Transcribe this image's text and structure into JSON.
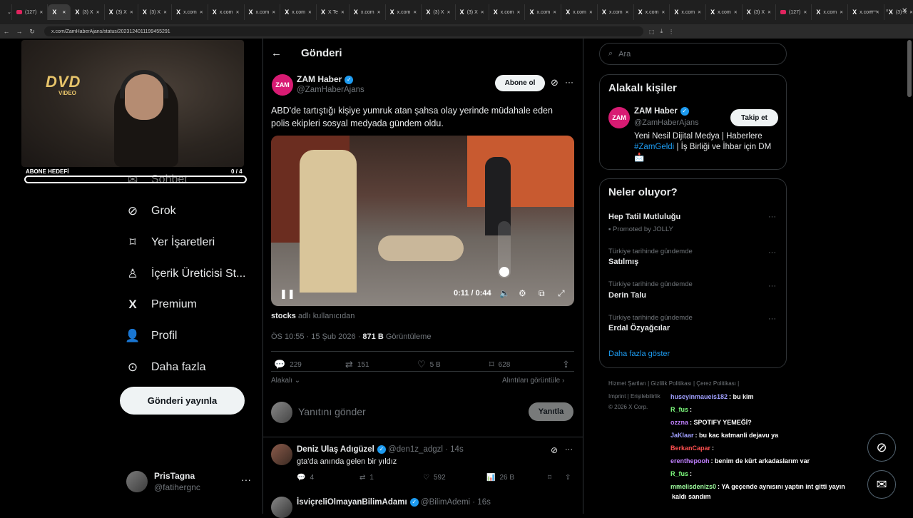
{
  "browser": {
    "tabs": [
      "(127)",
      "",
      "(3) X",
      "(3) X",
      "(3) X",
      "x.com",
      "x.com",
      "x.com",
      "x.com",
      "X Te",
      "x.com",
      "x.com",
      "(3) X",
      "(3) X",
      "x.com",
      "x.com",
      "x.com",
      "x.com",
      "x.com",
      "x.com",
      "x.com",
      "(3) X",
      "(127)",
      "x.com",
      "x.com",
      "(3) X"
    ],
    "url": "x.com/ZamHaberAjans/status/2023124011199455291"
  },
  "overlay": {
    "dvd_text": "DVD",
    "dvd_sub": "VIDEO",
    "goal_label": "ABONE HEDEFİ",
    "goal_count": "0 / 4"
  },
  "nav": {
    "items": [
      {
        "label": "Sohbet",
        "icon": "mail-icon"
      },
      {
        "label": "Grok",
        "icon": "grok-icon"
      },
      {
        "label": "Yer İşaretleri",
        "icon": "bookmark-icon"
      },
      {
        "label": "İçerik Üreticisi St...",
        "icon": "creator-icon"
      },
      {
        "label": "Premium",
        "icon": "x-logo-icon"
      },
      {
        "label": "Profil",
        "icon": "profile-icon"
      },
      {
        "label": "Daha fazla",
        "icon": "more-circle-icon"
      }
    ],
    "post_button": "Gönderi yayınla",
    "account_name": "PrisTagna",
    "account_handle": "@fatihergnc"
  },
  "post": {
    "header": "Gönderi",
    "author_name": "ZAM Haber",
    "author_handle": "@ZamHaberAjans",
    "avatar_text": "ZAM",
    "follow_label": "Abone ol",
    "text": "ABD'de tartıştığı kişiye yumruk atan şahsa olay yerinde müdahale eden polis ekipleri sosyal medyada gündem oldu.",
    "video_time": "0:11 / 0:44",
    "source_user": "stocks",
    "source_suffix": "adlı kullanıcıdan",
    "timestamp": "ÖS 10:55 · 15 Şub 2026 · ",
    "views": "871 B",
    "views_label": "Görüntüleme",
    "replies": "229",
    "reposts": "151",
    "likes": "5 B",
    "bookmarks": "628",
    "relevant_label": "Alakalı",
    "quotes_label": "Alıntıları görüntüle",
    "reply_placeholder": "Yanıtını gönder",
    "reply_button": "Yanıtla"
  },
  "comments": [
    {
      "name": "Deniz Ulaş Adıgüzel",
      "handle": "@den1z_adgzl · 14s",
      "text": "gta'da anında gelen bir yıldız",
      "replies": "4",
      "reposts": "1",
      "likes": "592",
      "views": "26 B"
    },
    {
      "name": "İsviçreliOlmayanBilimAdamı",
      "handle": "@BilimAdemi · 16s"
    }
  ],
  "right": {
    "search_placeholder": "Ara",
    "related_title": "Alakalı kişiler",
    "related_name": "ZAM Haber",
    "related_handle": "@ZamHaberAjans",
    "related_bio_1": "Yeni Nesil Dijital Medya | Haberlere ",
    "related_bio_tag": "#ZamGeldi",
    "related_bio_2": " | İş Birliği ve İhbar için DM 📩",
    "follow_label": "Takip et",
    "trending_title": "Neler oluyor?",
    "trends": [
      {
        "context": "",
        "name": "Hep Tatil Mutluluğu",
        "sub": "Promoted by JOLLY"
      },
      {
        "context": "Türkiye tarihinde gündemde",
        "name": "Satılmış"
      },
      {
        "context": "Türkiye tarihinde gündemde",
        "name": "Derin Talu"
      },
      {
        "context": "Türkiye tarihinde gündemde",
        "name": "Erdal Özyağcılar"
      }
    ],
    "show_more": "Daha fazla göster",
    "footer_1": "Hizmet Şartları  |  Gizlilik Politikası  |  Çerez Politikası  |",
    "footer_2": "Imprint  |  Erişilebilirlik",
    "footer_3": "© 2026 X Corp."
  },
  "chat": [
    {
      "user": "huseyinmaueis182",
      "color": "#a0a0ff",
      "msg": ": bu kim"
    },
    {
      "user": "R_fus",
      "color": "#7fff7f",
      "msg": ":"
    },
    {
      "user": "ozzna",
      "color": "#c080ff",
      "msg": ": SPOTIFY YEMEĞİ?"
    },
    {
      "user": "JaKlaar",
      "color": "#a0a0ff",
      "msg": ": bu kac katmanli dejavu ya"
    },
    {
      "user": "BerkanCapar",
      "color": "#ff5050",
      "msg": ":"
    },
    {
      "user": "erenthepooh",
      "color": "#c080ff",
      "msg": ": benim de kürt arkadaslarım var"
    },
    {
      "user": "R_fus",
      "color": "#7fff7f",
      "msg": ":"
    },
    {
      "user": "mmelisdenizs0",
      "color": "#a0ffa0",
      "msg": ": YA geçende aynısını yaptın int gitti yayın"
    },
    {
      "user": "",
      "color": "#ffffff",
      "msg": "kaldı sandım"
    }
  ]
}
